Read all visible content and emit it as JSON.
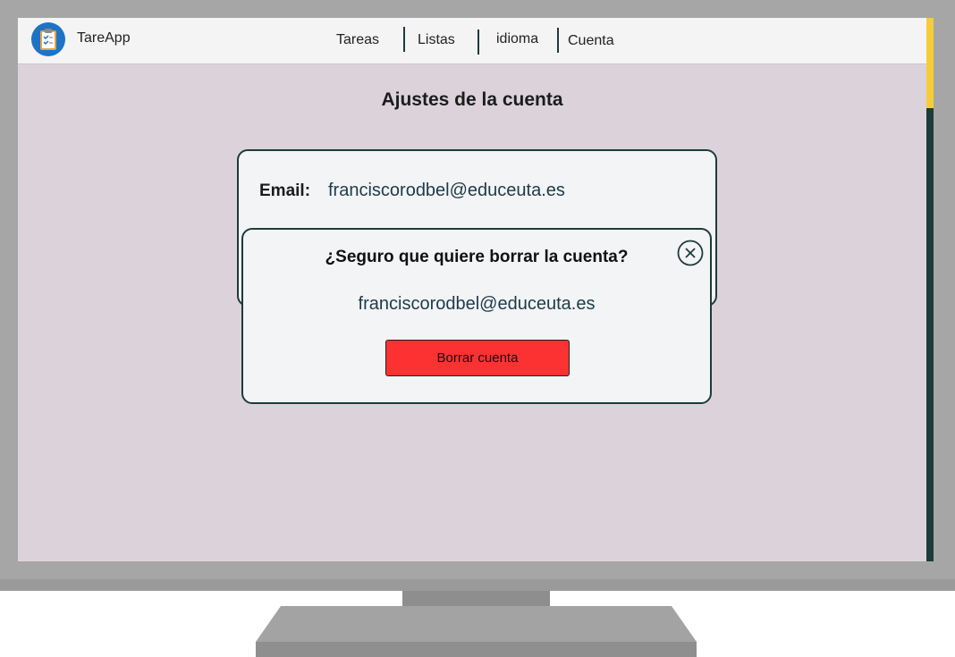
{
  "app": {
    "name": "TareApp",
    "logo_icon": "clipboard-icon"
  },
  "nav": {
    "items": [
      "Tareas",
      "Listas",
      "idioma",
      "Cuenta"
    ]
  },
  "page": {
    "title": "Ajustes de la cuenta"
  },
  "account": {
    "email_label": "Email:",
    "email_value": "franciscorodbel@educeuta.es"
  },
  "modal": {
    "title": "¿Seguro que quiere borrar la cuenta?",
    "email": "franciscorodbel@educeuta.es",
    "delete_button": "Borrar cuenta",
    "close_icon": "close-circle-icon"
  },
  "colors": {
    "screen_bg": "#dcd3da",
    "accent_dark": "#1e3a3d",
    "danger": "#fc3131",
    "scrollbar_thumb": "#f5cd3b",
    "logo_blue": "#1e73c4"
  }
}
